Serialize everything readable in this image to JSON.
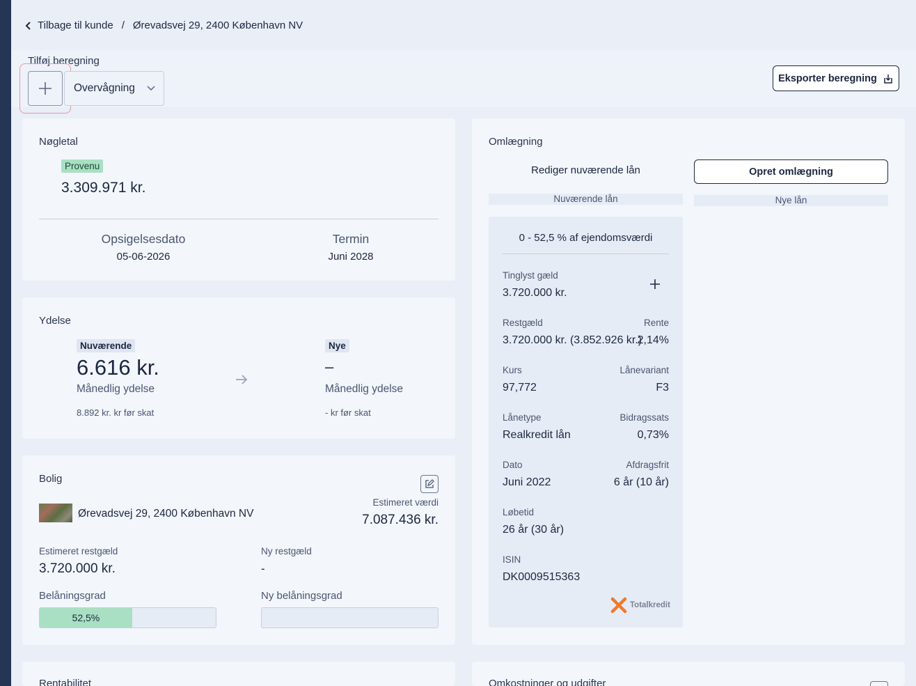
{
  "breadcrumb": {
    "back_label": "Tilbage til kunde",
    "separator": "/",
    "current": "Ørevadsvej 29, 2400 København NV"
  },
  "toolbar": {
    "label": "Tilføj beregning",
    "select_value": "Overvågning",
    "export_label": "Eksporter beregning"
  },
  "noegletal": {
    "title": "Nøgletal",
    "badge": "Provenu",
    "provenu_value": "3.309.971 kr.",
    "opsigelse_label": "Opsigelsesdato",
    "opsigelse_value": "05-06-2026",
    "termin_label": "Termin",
    "termin_value": "Juni 2028"
  },
  "ydelse": {
    "title": "Ydelse",
    "current_badge": "Nuværende",
    "current_value": "6.616 kr.",
    "current_sub": "Månedlig ydelse",
    "current_pre_tax": "8.892 kr. kr før skat",
    "new_badge": "Nye",
    "new_value": "–",
    "new_sub": "Månedlig ydelse",
    "new_pre_tax": "- kr før skat"
  },
  "bolig": {
    "title": "Bolig",
    "address": "Ørevadsvej 29, 2400 København NV",
    "estimated_value_label": "Estimeret værdi",
    "estimated_value": "7.087.436 kr.",
    "restgaeld_label": "Estimeret restgæld",
    "restgaeld_value": "3.720.000 kr.",
    "ny_restgaeld_label": "Ny restgæld",
    "ny_restgaeld_value": "-",
    "belaaning_label": "Belåningsgrad",
    "belaaning_value": "52,5%",
    "belaaning_fraction": 0.525,
    "ny_belaaning_label": "Ny belåningsgrad"
  },
  "omlaegning": {
    "title": "Omlægning",
    "edit_current_label": "Rediger nuværende lån",
    "create_label": "Opret omlægning",
    "current_loans_label": "Nuværende lån",
    "new_loans_label": "Nye lån",
    "loan": {
      "range": "0 - 52,5 % af ejendomsværdi",
      "tinglyst_label": "Tinglyst gæld",
      "tinglyst_value": "3.720.000 kr.",
      "restgaeld_label": "Restgæld",
      "restgaeld_value": "3.720.000 kr. (3.852.926 kr.)",
      "rente_label": "Rente",
      "rente_value": "2,14%",
      "kurs_label": "Kurs",
      "kurs_value": "97,772",
      "laanevariant_label": "Lånevariant",
      "laanevariant_value": "F3",
      "laanetype_label": "Lånetype",
      "laanetype_value": "Realkredit lån",
      "bidragssats_label": "Bidragssats",
      "bidragssats_value": "0,73%",
      "dato_label": "Dato",
      "dato_value": "Juni 2022",
      "afdragsfrit_label": "Afdragsfrit",
      "afdragsfrit_value": "6 år (10 år)",
      "loebetid_label": "Løbetid",
      "loebetid_value": "26 år (30 år)",
      "isin_label": "ISIN",
      "isin_value": "DK0009515363",
      "lender_logo": "Totalkredit"
    }
  },
  "bottom": {
    "rentabilitet_title": "Rentabilitet",
    "omkostninger_title": "Omkostninger og udgifter"
  },
  "colors": {
    "accent_green": "#a9e0c3",
    "sidebar": "#253554",
    "logo_orange": "#f07a2e"
  },
  "icons": [
    "chevron-left-icon",
    "plus-icon",
    "chevron-down-icon",
    "download-icon",
    "arrow-right-icon",
    "edit-icon"
  ]
}
